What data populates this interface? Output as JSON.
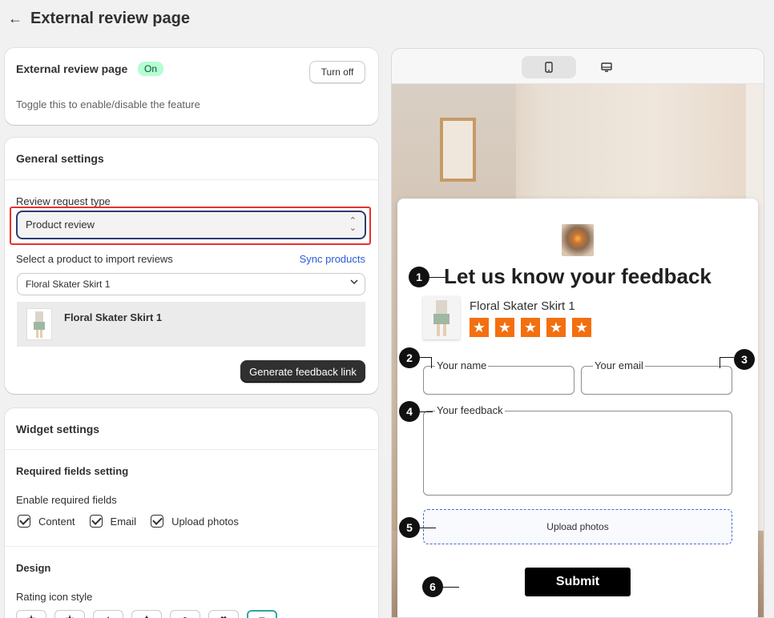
{
  "header": {
    "back_icon": "arrow-left-icon",
    "title": "External review page"
  },
  "feature_card": {
    "title": "External review page",
    "status_badge": "On",
    "turn_off_label": "Turn off",
    "description": "Toggle this to enable/disable the feature"
  },
  "general_settings": {
    "title": "General settings",
    "review_request_type_label": "Review request type",
    "review_request_type_value": "Product review",
    "select_product_label": "Select a product to import reviews",
    "sync_link": "Sync products",
    "product_dropdown_value": "Floral Skater Skirt 1",
    "selected_product_name": "Floral Skater Skirt 1",
    "generate_button": "Generate feedback link"
  },
  "widget_settings": {
    "title": "Widget settings",
    "required_fields_title": "Required fields setting",
    "enable_required_label": "Enable required fields",
    "checkboxes": [
      {
        "label": "Content",
        "checked": true
      },
      {
        "label": "Email",
        "checked": true
      },
      {
        "label": "Upload photos",
        "checked": true
      }
    ],
    "design_title": "Design",
    "rating_icon_style_label": "Rating icon style"
  },
  "preview": {
    "device_icons": [
      "mobile-icon",
      "desktop-icon"
    ],
    "form_title": "Let us know your feedback",
    "product_name": "Floral Skater Skirt 1",
    "star_count": 5,
    "star_color": "#f36f0f",
    "name_label": "Your name",
    "email_label": "Your email",
    "feedback_label": "Your feedback",
    "upload_label": "Upload photos",
    "submit_label": "Submit",
    "markers": [
      "1",
      "2",
      "3",
      "4",
      "5",
      "6"
    ]
  },
  "colors": {
    "highlight": "#e8302d",
    "badge_bg": "#b4fed2",
    "link": "#2c5bdb"
  }
}
